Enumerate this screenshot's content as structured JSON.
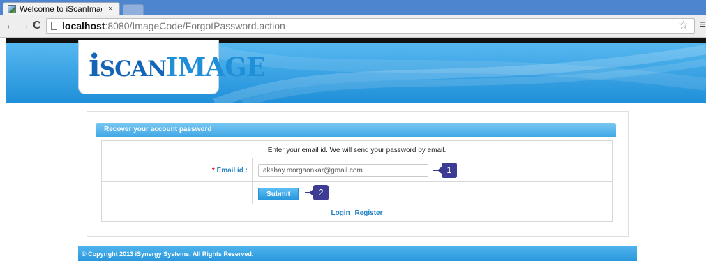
{
  "browser": {
    "tab_title": "Welcome to iScanImag",
    "tab_close": "×",
    "url_host": "localhost",
    "url_rest": ":8080/ImageCode/ForgotPassword.action",
    "back_icon": "←",
    "forward_icon": "→",
    "reload_icon": "C",
    "star_icon": "☆",
    "menu_icon": "≡"
  },
  "header": {
    "logo_i": "i",
    "logo_scan": "SCAN",
    "logo_image": "IMAGE"
  },
  "panel": {
    "title": "Recover your account password",
    "instruction": "Enter your email id. We will send your password by email.",
    "email_required_mark": "*",
    "email_label": "Email id :",
    "email_value": "akshay.morgaonkar@gmail.com",
    "submit_label": "Submit",
    "login_link": "Login",
    "register_link": "Register"
  },
  "callouts": [
    "1",
    "2"
  ],
  "footer": {
    "copyright": "© Copyright 2013 iSynergy Systems. All Rights Reserved."
  },
  "colors": {
    "header_blue": "#1f8fd8",
    "panel_blue": "#42a8e6",
    "label_blue": "#2c87c7",
    "callout": "#3c3c94"
  }
}
